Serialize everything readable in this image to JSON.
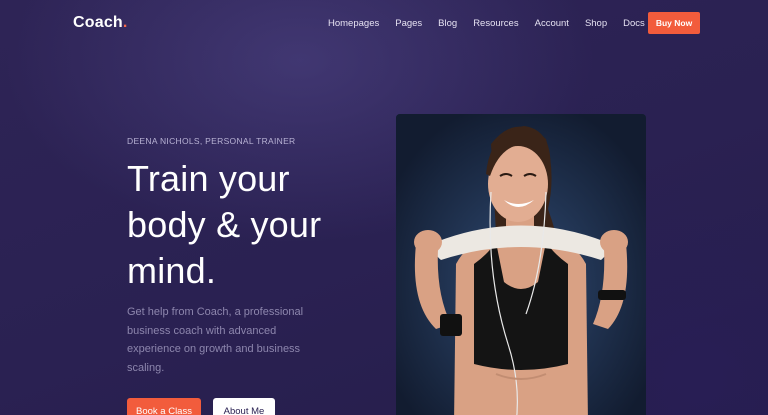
{
  "header": {
    "logo_text": "Coach",
    "logo_dot": ".",
    "nav_items": [
      "Homepages",
      "Pages",
      "Blog",
      "Resources",
      "Account",
      "Shop",
      "Docs"
    ],
    "cta_label": "Buy Now"
  },
  "hero": {
    "eyebrow": "DEENA NICHOLS, PERSONAL TRAINER",
    "headline": "Train your body & your mind.",
    "lead": "Get help from Coach, a professional business coach with advanced experience on growth and business scaling.",
    "primary_button": "Book a Class",
    "secondary_button": "About Me",
    "image": {
      "subject": "smiling woman with towel around neck and earphones"
    }
  },
  "colors": {
    "background": "#2b2150",
    "accent": "#f25c3c",
    "text_muted": "#8d86ad"
  }
}
